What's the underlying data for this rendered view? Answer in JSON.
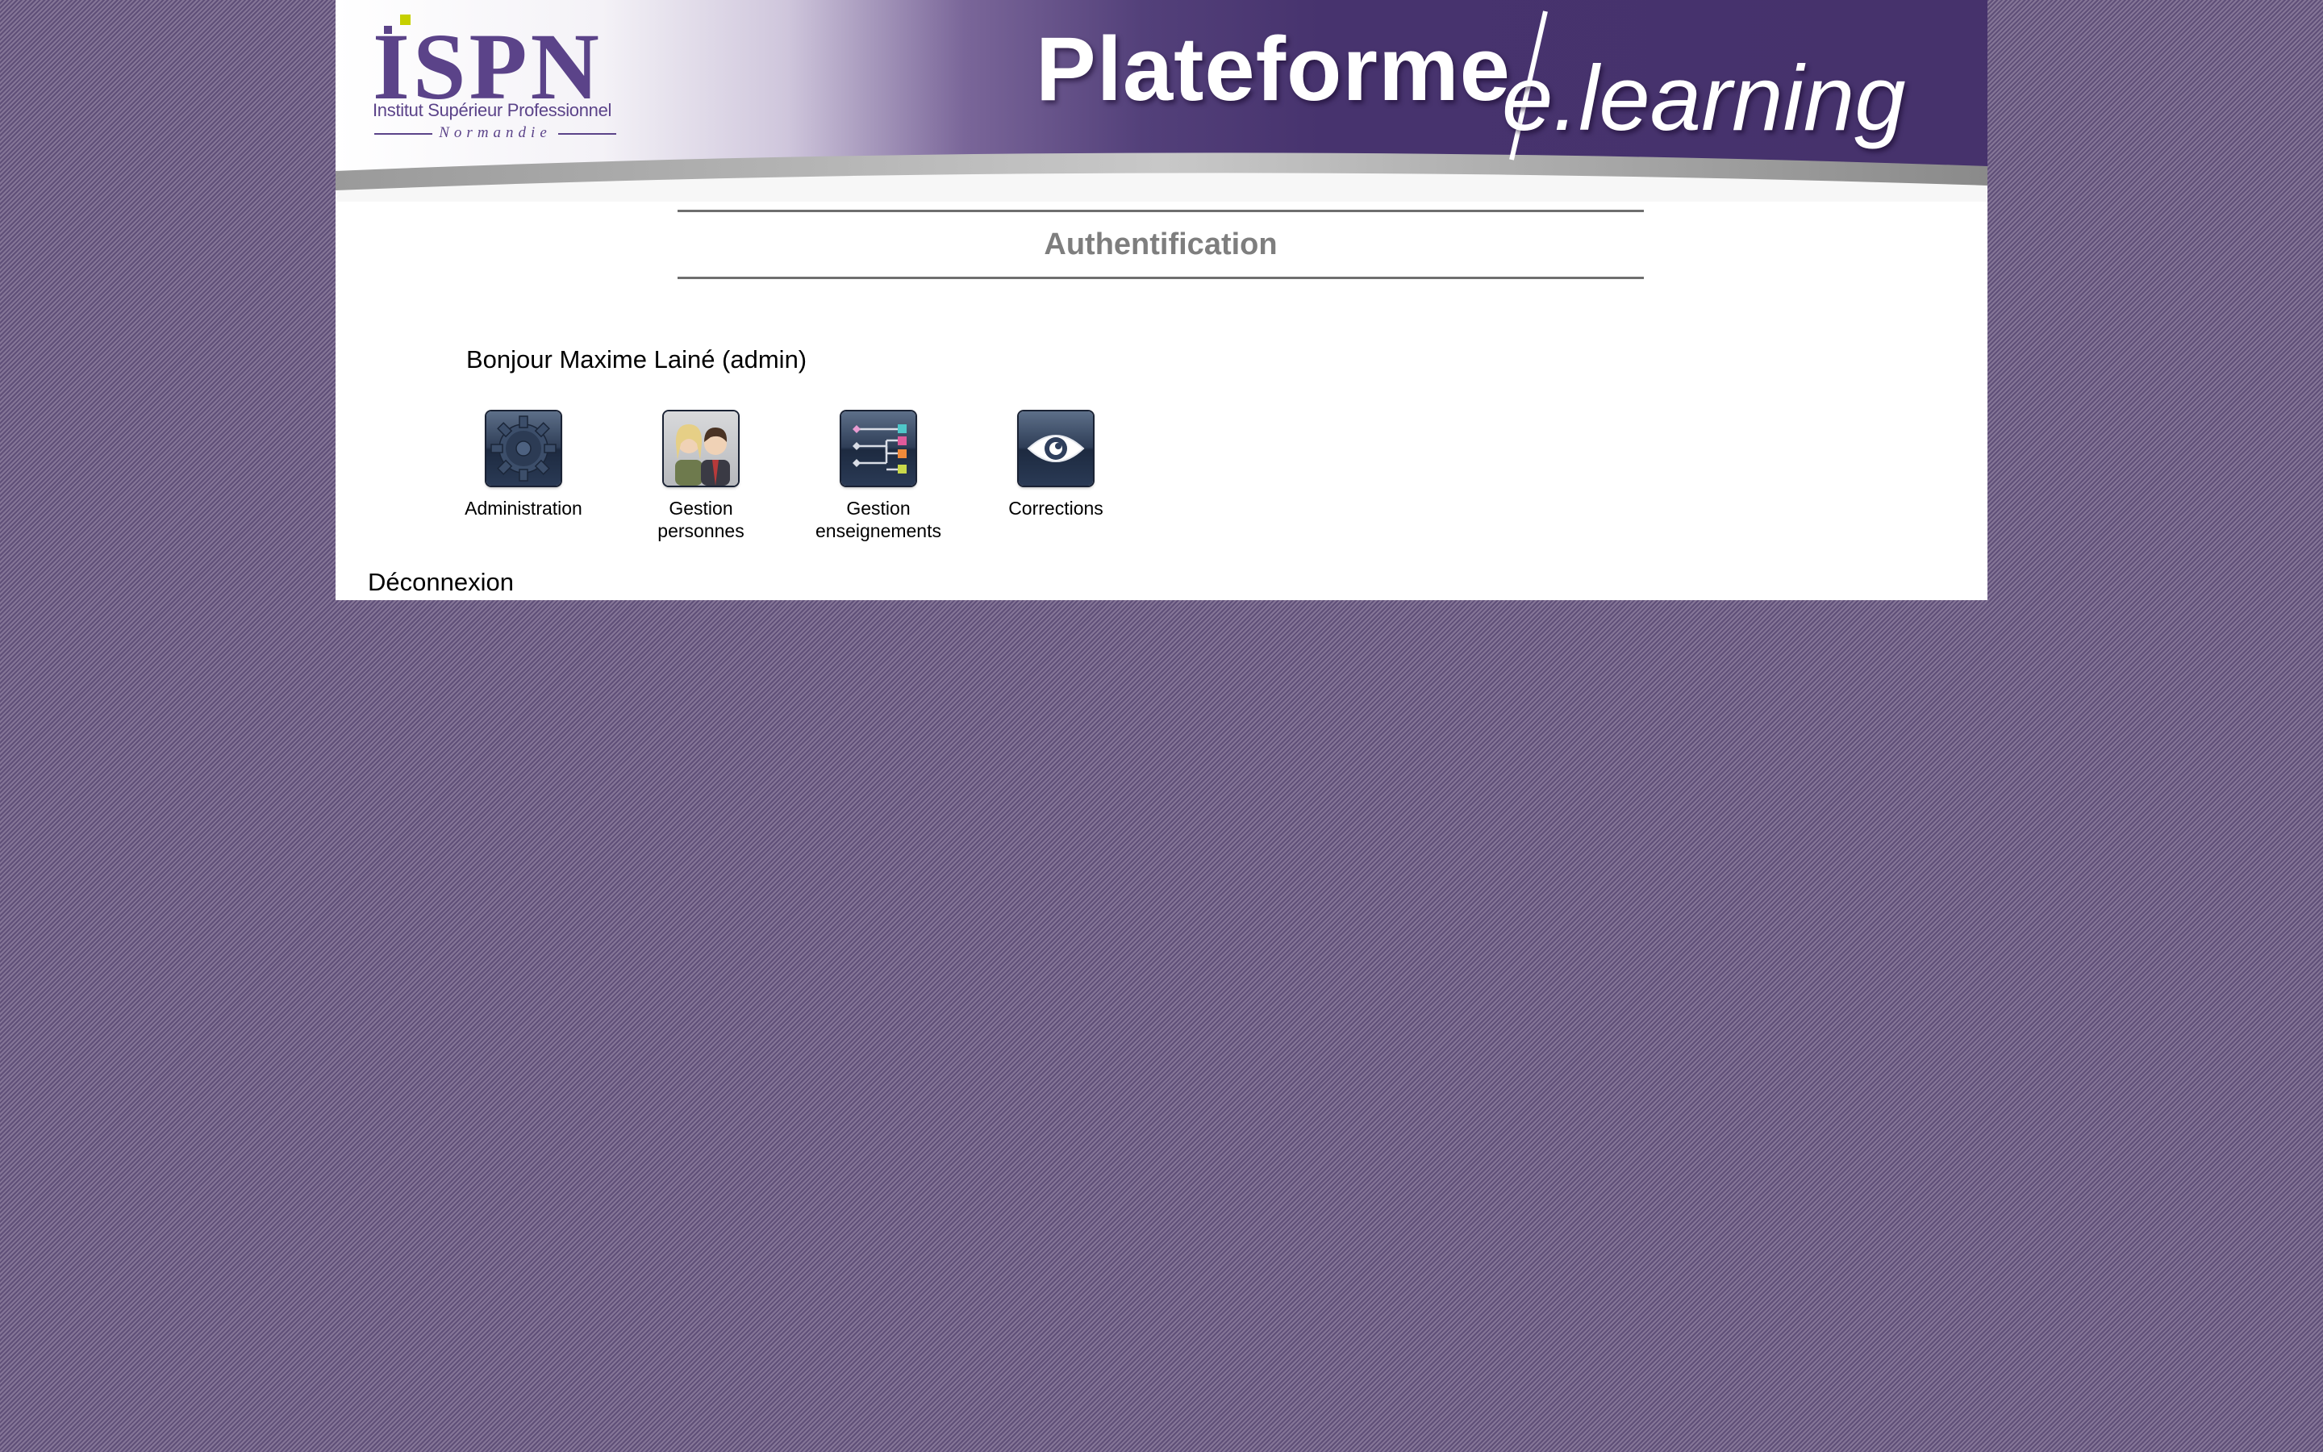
{
  "banner": {
    "logo": {
      "letters": "ISPN",
      "subtitle": "Institut Supérieur Professionnel",
      "region": "Normandie"
    },
    "platform_title": "Plateforme",
    "platform_subtitle": "e.learning"
  },
  "main": {
    "title": "Authentification",
    "greeting": "Bonjour Maxime Lainé (admin)",
    "tiles": [
      {
        "label": "Administration",
        "icon": "gear-icon"
      },
      {
        "label": "Gestion\npersonnes",
        "icon": "people-icon"
      },
      {
        "label": "Gestion\nenseignements",
        "icon": "org-chart-icon"
      },
      {
        "label": "Corrections",
        "icon": "eye-icon"
      }
    ],
    "logout_label": "Déconnexion"
  },
  "colors": {
    "brand_purple": "#5b4389",
    "banner_purple": "#46326c",
    "logo_accent": "#c6d000",
    "title_gray": "#7e7e7e"
  }
}
